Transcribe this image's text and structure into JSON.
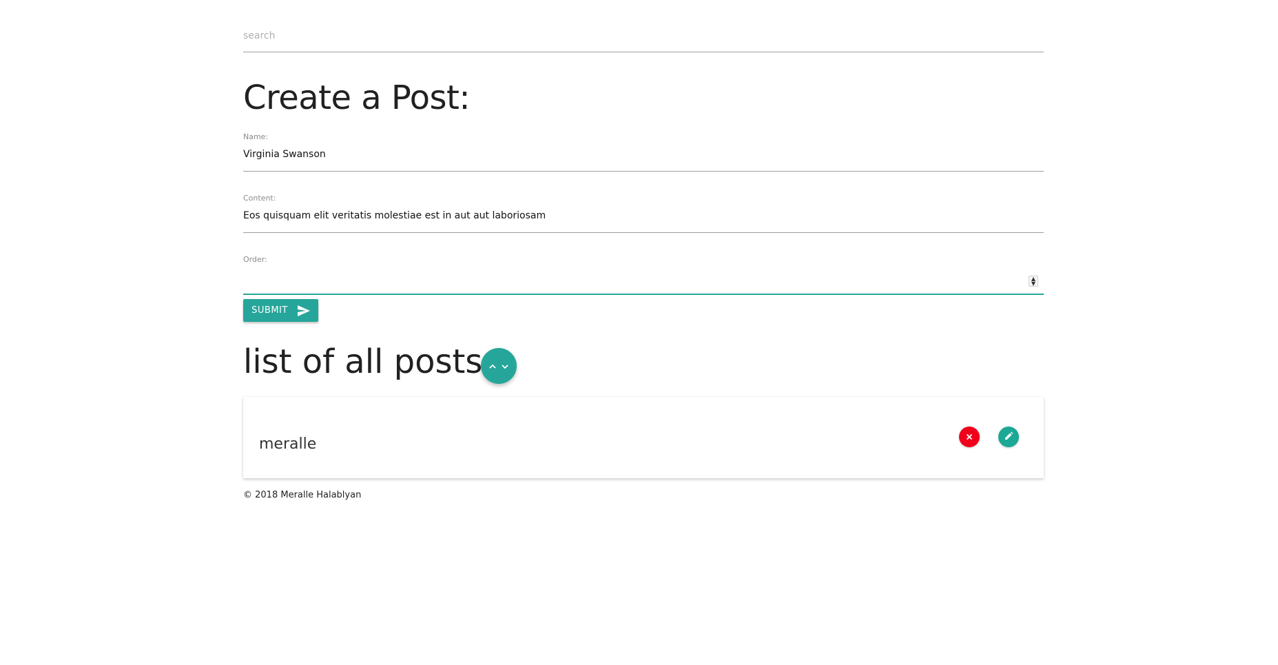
{
  "search": {
    "placeholder": "search",
    "value": ""
  },
  "form": {
    "title": "Create a Post:",
    "name_label": "Name:",
    "name_value": "Virginia Swanson",
    "content_label": "Content:",
    "content_value": "Eos quisquam elit veritatis molestiae est in aut aut laboriosam",
    "order_label": "Order:",
    "order_value": "",
    "submit_label": "SUBMIT",
    "submit_icon": "send-icon"
  },
  "list": {
    "title": "list of all posts:",
    "sort_icons": [
      "chevron-up-icon",
      "chevron-down-icon"
    ],
    "posts": [
      {
        "name": "meralle",
        "delete_icon": "close-icon",
        "edit_icon": "pencil-icon"
      }
    ]
  },
  "footer": {
    "text": "© 2018 Meralle Halablyan"
  },
  "colors": {
    "accent": "#26a69a",
    "delete": "#f0001a",
    "edit": "#1ba895"
  }
}
